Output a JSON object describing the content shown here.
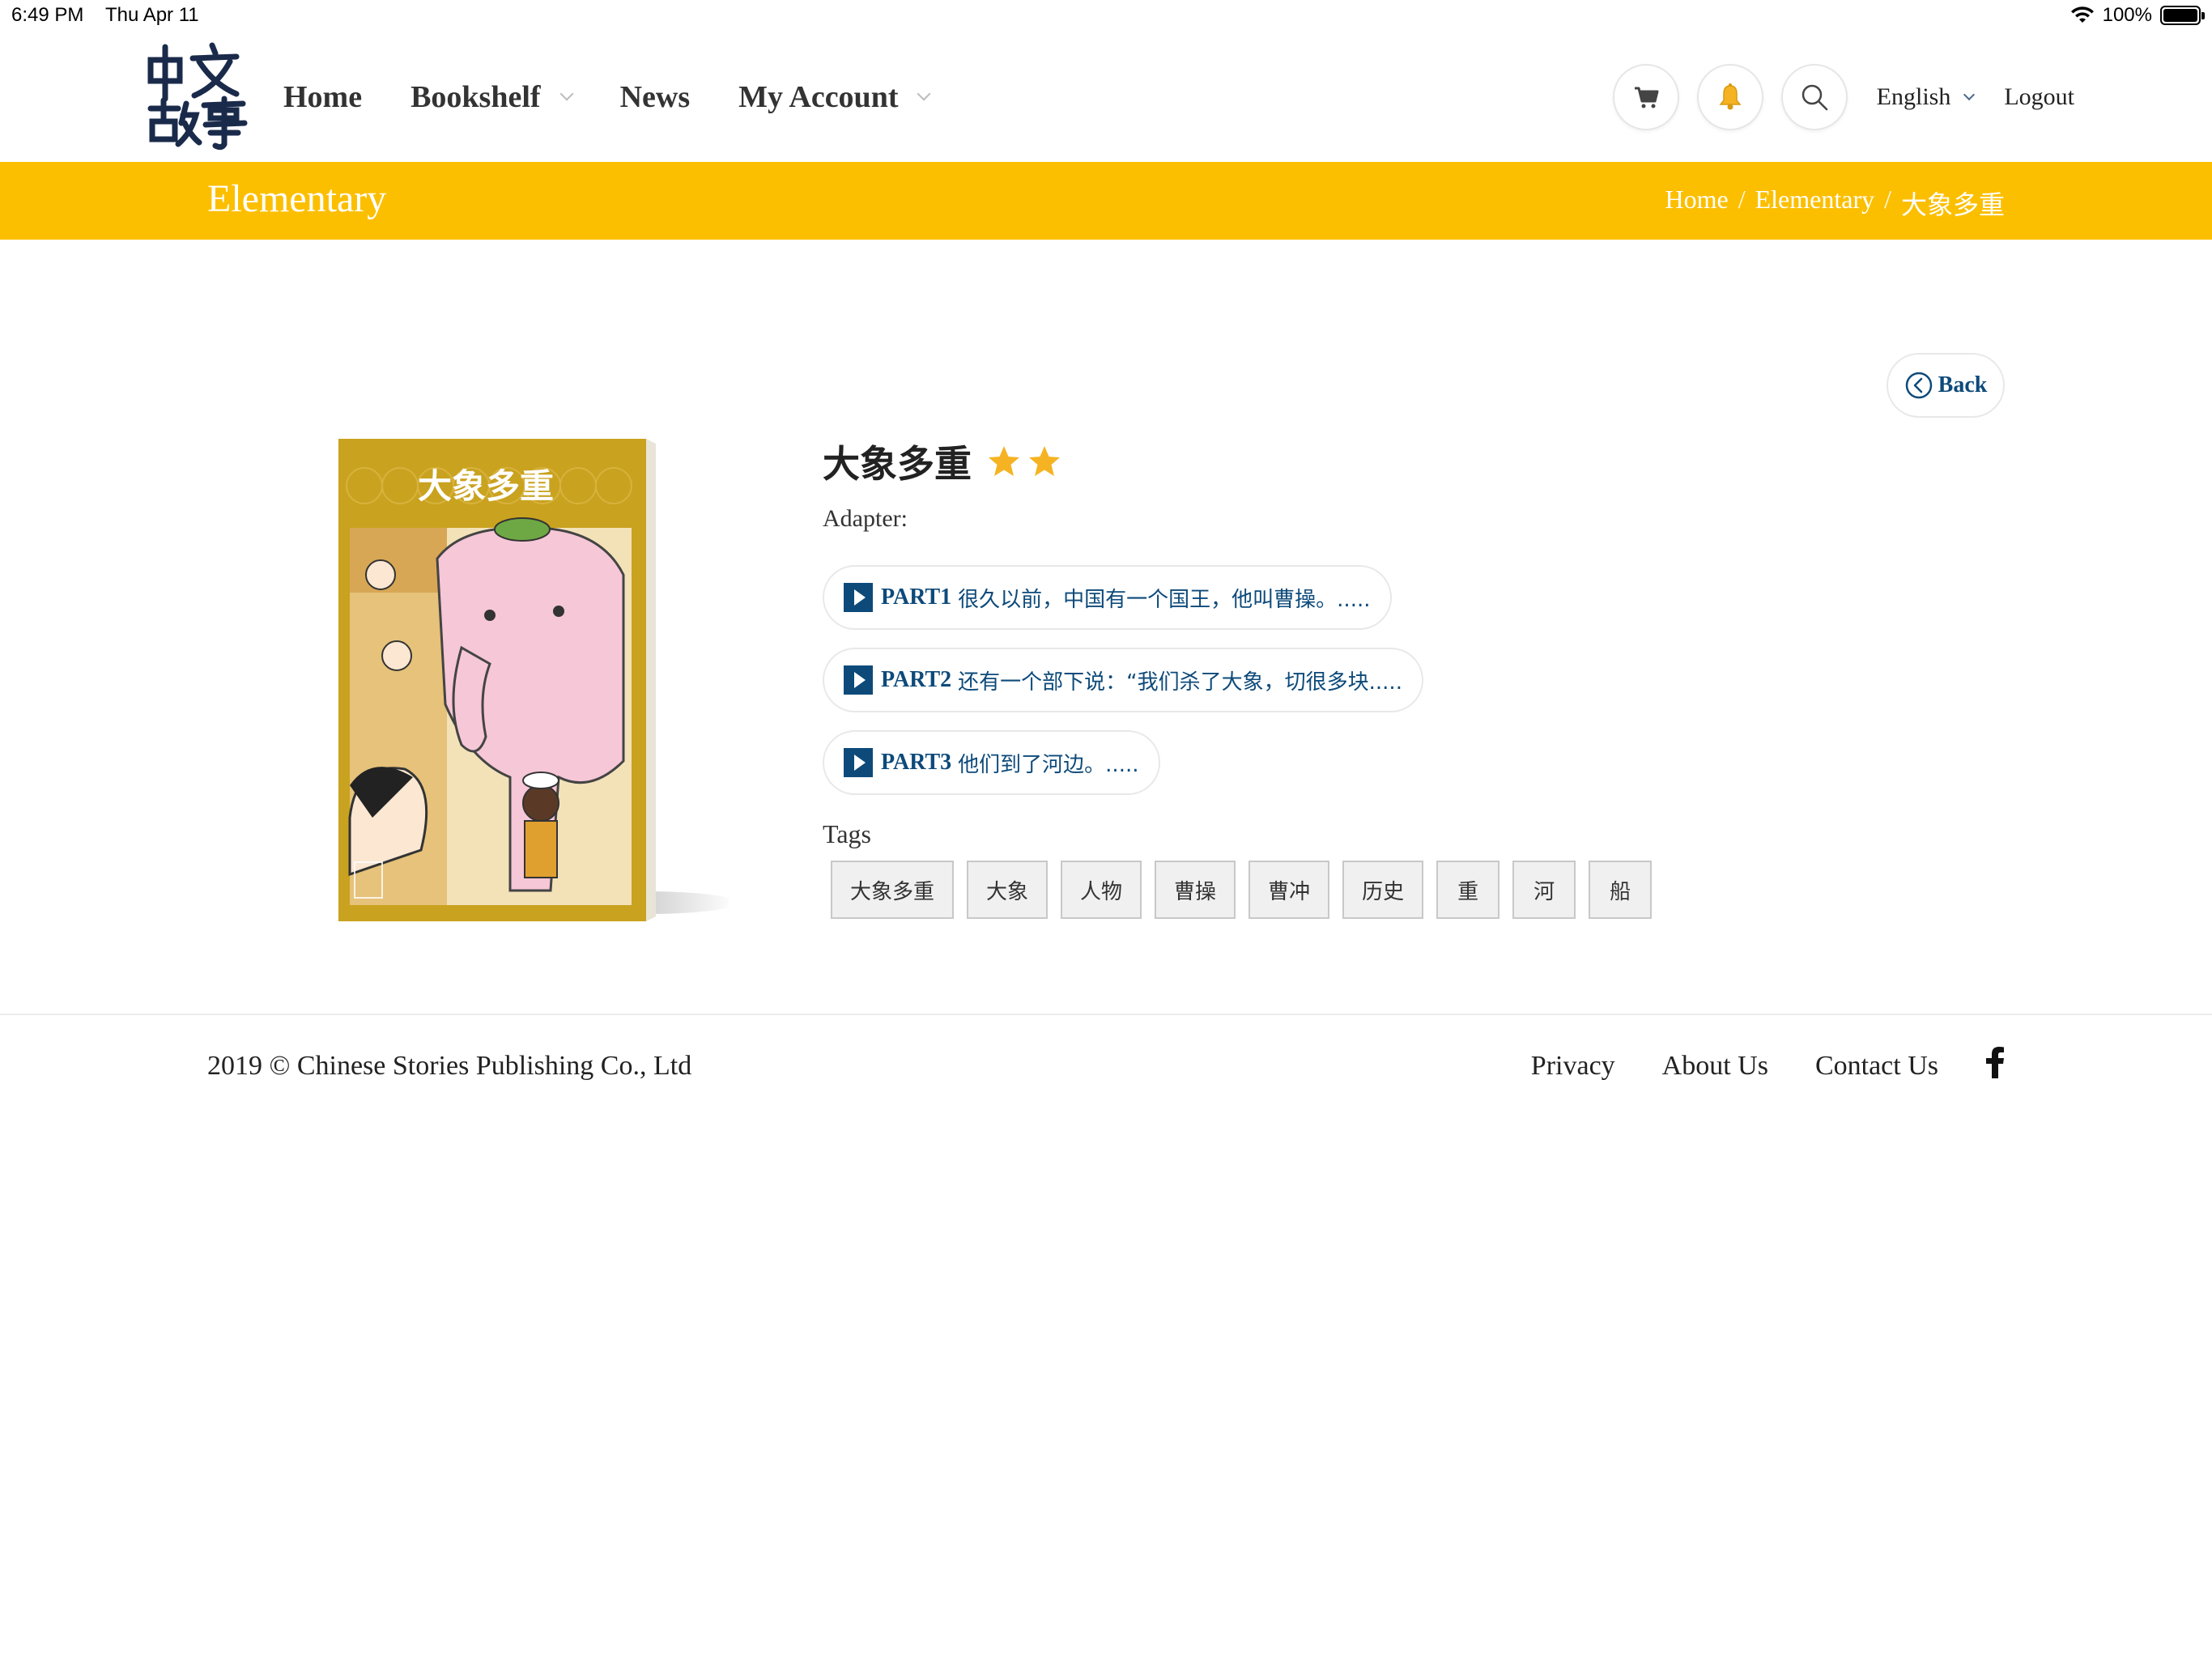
{
  "status_bar": {
    "time": "6:49 PM",
    "date": "Thu Apr 11",
    "battery": "100%"
  },
  "header": {
    "logo_alt": "中文故事",
    "nav": [
      {
        "label": "Home"
      },
      {
        "label": "Bookshelf"
      },
      {
        "label": "News"
      },
      {
        "label": "My Account"
      }
    ],
    "language": "English",
    "logout": "Logout",
    "icons": [
      "cart-icon",
      "bell-icon",
      "search-icon"
    ]
  },
  "banner": {
    "title": "Elementary",
    "breadcrumb": [
      "Home",
      "Elementary",
      "大象多重"
    ],
    "separator": "/",
    "color": "#fcbf00"
  },
  "back_button": {
    "label": "Back"
  },
  "book": {
    "cover_title": "大象多重",
    "title": "大象多重",
    "stars": 2,
    "adapter_label": "Adapter:",
    "parts": [
      {
        "label": "PART1",
        "text": "很久以前，中国有一个国王，他叫曹操。....."
      },
      {
        "label": "PART2",
        "text": "还有一个部下说：“我们杀了大象，切很多块....."
      },
      {
        "label": "PART3",
        "text": "他们到了河边。....."
      }
    ],
    "tags_title": "Tags",
    "tags": [
      "大象多重",
      "大象",
      "人物",
      "曹操",
      "曹冲",
      "历史",
      "重",
      "河",
      "船"
    ]
  },
  "footer": {
    "copyright": "2019 © Chinese Stories Publishing Co., Ltd",
    "links": [
      "Privacy",
      "About Us",
      "Contact Us"
    ]
  },
  "colors": {
    "accent": "#fcbf00",
    "link": "#0d4a7a",
    "star": "#f5b323"
  }
}
